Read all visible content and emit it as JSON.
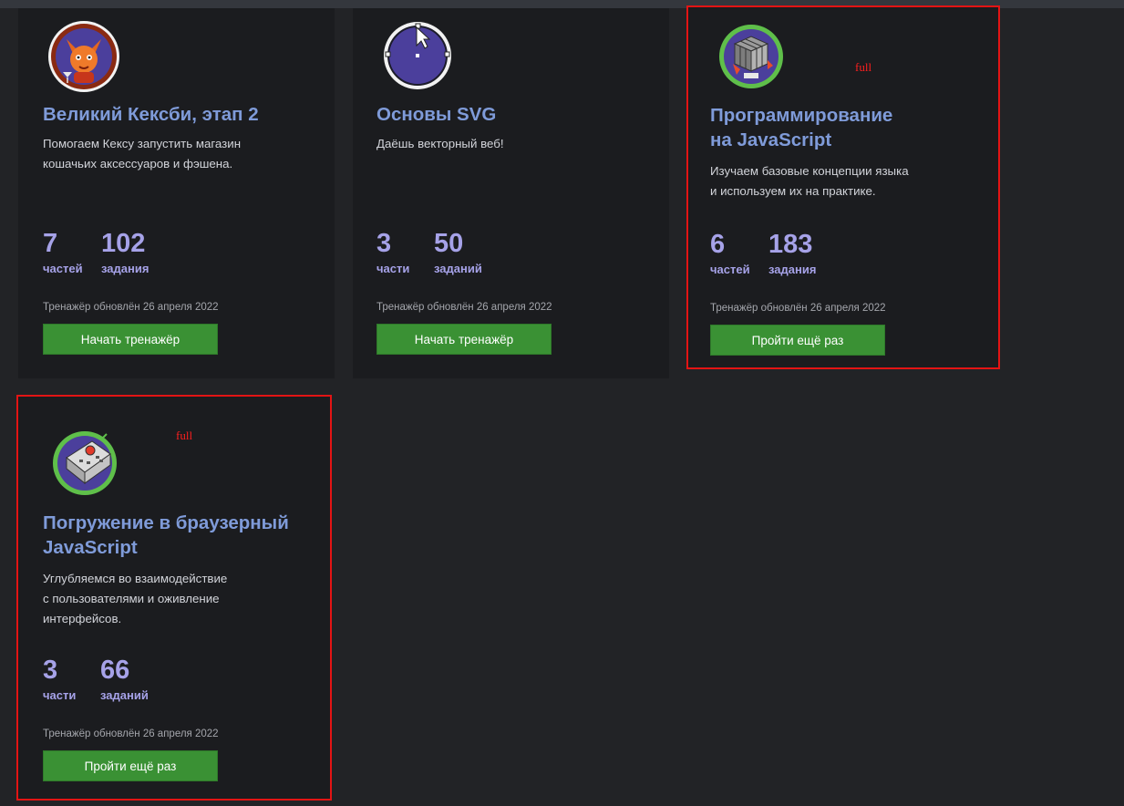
{
  "colors": {
    "background": "#222326",
    "card": "#1b1c1f",
    "title": "#7f9bd9",
    "stat": "#a6a2e8",
    "button": "#3a9134",
    "highlight": "#e31414"
  },
  "cards": [
    {
      "icon": "cat-with-martini-icon",
      "title": "Великий Кексби, этап 2",
      "description": [
        "Помогаем Кексу запустить магазин",
        "кошачьих аксессуаров и фэшена."
      ],
      "parts_count": "7",
      "parts_label": "частей",
      "tasks_count": "102",
      "tasks_label": "задания",
      "updated": "Тренажёр обновлён 26 апреля 2022",
      "button_label": "Начать тренажёр",
      "completion_flag": ""
    },
    {
      "icon": "svg-cursor-circle-icon",
      "title": "Основы SVG",
      "description": [
        "Даёшь векторный веб!"
      ],
      "parts_count": "3",
      "parts_label": "части",
      "tasks_count": "50",
      "tasks_label": "заданий",
      "updated": "Тренажёр обновлён 26 апреля 2022",
      "button_label": "Начать тренажёр",
      "completion_flag": ""
    },
    {
      "icon": "rubiks-cube-icon",
      "title": [
        "Программирование",
        "на JavaScript"
      ],
      "description": [
        "Изучаем базовые концепции языка",
        "и используем их на практике."
      ],
      "parts_count": "6",
      "parts_label": "частей",
      "tasks_count": "183",
      "tasks_label": "задания",
      "updated": "Тренажёр обновлён 26 апреля 2022",
      "button_label": "Пройти ещё раз",
      "completion_flag": "full"
    },
    {
      "icon": "control-panel-box-icon",
      "title": [
        "Погружение в браузерный",
        "JavaScript"
      ],
      "description": [
        "Углубляемся во взаимодействие",
        "с пользователями и оживление",
        "интерфейсов."
      ],
      "parts_count": "3",
      "parts_label": "части",
      "tasks_count": "66",
      "tasks_label": "заданий",
      "updated": "Тренажёр обновлён 26 апреля 2022",
      "button_label": "Пройти ещё раз",
      "completion_flag": "full"
    }
  ]
}
